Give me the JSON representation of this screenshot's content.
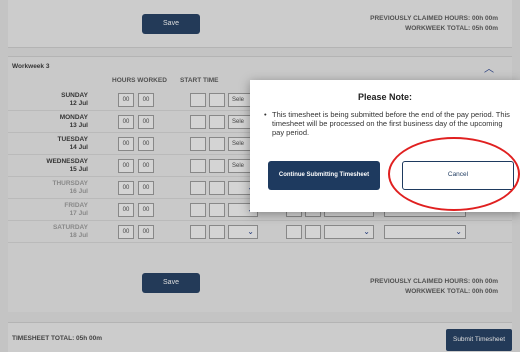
{
  "top": {
    "save_label": "Save",
    "previously_claimed": "PREVIOUSLY CLAIMED HOURS: 00h 00m",
    "workweek_total": "WORKWEEK TOTAL: 05h 00m"
  },
  "workweek": {
    "title": "Workweek 3",
    "col_hours": "HOURS WORKED",
    "col_start": "START TIME",
    "rows": [
      {
        "day": "SUNDAY",
        "date": "12 Jul",
        "h": "00",
        "m": "00",
        "select": "Sele"
      },
      {
        "day": "MONDAY",
        "date": "13 Jul",
        "h": "00",
        "m": "00",
        "select": "Sele"
      },
      {
        "day": "TUESDAY",
        "date": "14 Jul",
        "h": "00",
        "m": "00",
        "select": "Sele"
      },
      {
        "day": "WEDNESDAY",
        "date": "15 Jul",
        "h": "00",
        "m": "00",
        "select": "Sele"
      },
      {
        "day": "THURSDAY",
        "date": "16 Jul",
        "h": "00",
        "m": "00"
      },
      {
        "day": "FRIDAY",
        "date": "17 Jul",
        "h": "00",
        "m": "00"
      },
      {
        "day": "SATURDAY",
        "date": "18 Jul",
        "h": "00",
        "m": "00"
      }
    ],
    "save_label": "Save",
    "previously_claimed": "PREVIOUSLY CLAIMED HOURS: 00h 00m",
    "workweek_total": "WORKWEEK TOTAL: 00h 00m"
  },
  "footer": {
    "timesheet_total": "TIMESHEET TOTAL: 05h 00m",
    "submit_label": "Submit Timesheet"
  },
  "modal": {
    "title": "Please Note:",
    "message": "This timesheet is being submitted before the end of the pay period. This timesheet will be processed on the first business day of the upcoming pay period.",
    "continue_label": "Continue Submitting Timesheet",
    "cancel_label": "Cancel"
  },
  "colors": {
    "primary": "#1e3a5f",
    "highlight_circle": "#e02020"
  }
}
